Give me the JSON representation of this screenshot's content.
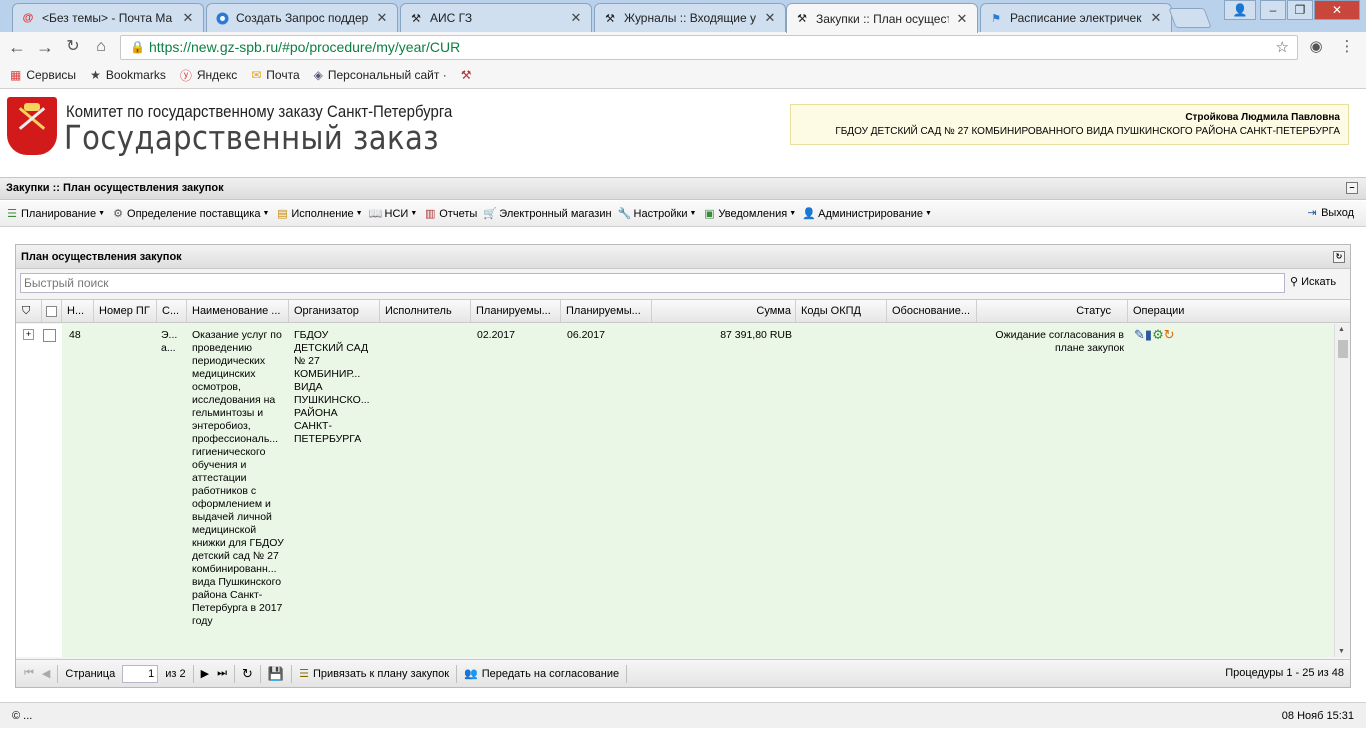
{
  "browser": {
    "tabs": [
      {
        "title": "<Без темы> - Почта Ма",
        "icon": "mail-at-icon",
        "active": false
      },
      {
        "title": "Создать Запрос поддер",
        "icon": "support-globe-icon",
        "active": false
      },
      {
        "title": "АИС ГЗ",
        "icon": "gavel-icon",
        "active": false
      },
      {
        "title": "Журналы :: Входящие у",
        "icon": "gavel-icon",
        "active": false
      },
      {
        "title": "Закупки :: План осущест",
        "icon": "gavel-icon",
        "active": true
      },
      {
        "title": "Расписание электричек",
        "icon": "train-icon",
        "active": false
      }
    ],
    "url": "https://new.gz-spb.ru/#po/procedure/my/year/CUR",
    "bookmarks": [
      {
        "label": "Сервисы",
        "icon": "apps-grid-icon"
      },
      {
        "label": "Bookmarks",
        "icon": "star-icon"
      },
      {
        "label": "Яндекс",
        "icon": "yandex-icon"
      },
      {
        "label": "Почта",
        "icon": "mail-envelope-icon"
      },
      {
        "label": "Персональный сайт ·",
        "icon": "site-icon"
      },
      {
        "label": "",
        "icon": "gavel-icon"
      }
    ]
  },
  "header": {
    "subtitle": "Комитет по государственному заказу Санкт-Петербурга",
    "title": "Государственный заказ",
    "user_name": "Стройкова Людмила Павловна",
    "organization": "ГБДОУ ДЕТСКИЙ САД № 27 КОМБИНИРОВАННОГО ВИДА ПУШКИНСКОГО РАЙОНА САНКТ-ПЕТЕРБУРГА"
  },
  "panel": {
    "title": "Закупки :: План осуществления закупок"
  },
  "menu": {
    "items": [
      {
        "label": "Планирование",
        "dropdown": true,
        "icon": "planning-icon"
      },
      {
        "label": "Определение поставщика",
        "dropdown": true,
        "icon": "gears-icon"
      },
      {
        "label": "Исполнение",
        "dropdown": true,
        "icon": "execution-icon"
      },
      {
        "label": "НСИ",
        "dropdown": true,
        "icon": "book-icon"
      },
      {
        "label": "Отчеты",
        "dropdown": false,
        "icon": "report-icon"
      },
      {
        "label": "Электронный магазин",
        "dropdown": false,
        "icon": "cart-icon"
      },
      {
        "label": "Настройки",
        "dropdown": true,
        "icon": "wrench-icon"
      },
      {
        "label": "Уведомления",
        "dropdown": true,
        "icon": "notification-icon"
      },
      {
        "label": "Администрирование",
        "dropdown": true,
        "icon": "user-icon"
      }
    ],
    "logout": "Выход"
  },
  "grid": {
    "title": "План осуществления закупок",
    "search_placeholder": "Быстрый поиск",
    "search_button": "Искать",
    "columns": [
      "Н...",
      "Номер ПГ",
      "С...",
      "Наименование ...",
      "Организатор",
      "Исполнитель",
      "Планируемы...",
      "Планируемы...",
      "Сумма",
      "Коды ОКПД",
      "Обоснование...",
      "Статус",
      "Операции"
    ],
    "row": {
      "number": "48",
      "pg_number": "",
      "s": "Э... а...",
      "name": "Оказание услуг по проведению периодических медицинских осмотров, исследования на гельминтозы и энтеробиоз, профессиональ... гигиенического обучения и аттестации работников с оформлением и выдачей личной медицинской книжки для ГБДОУ детский сад № 27 комбинированн... вида Пушкинского района Санкт-Петербурга в 2017 году",
      "organizer": "ГБДОУ ДЕТСКИЙ САД № 27 КОМБИНИР... ВИДА ПУШКИНСКО... РАЙОНА САНКТ-ПЕТЕРБУРГА",
      "executor": "",
      "plan_date1": "02.2017",
      "plan_date2": "06.2017",
      "sum": "87 391,80 RUB",
      "okpd": "",
      "justification": "",
      "status": "Ожидание согласования в плане закупок"
    },
    "paging": {
      "page_label": "Страница",
      "page": "1",
      "of": "из 2",
      "link_button": "Привязать к плану закупок",
      "send_button": "Передать на согласование",
      "info": "Процедуры 1 - 25 из 48"
    }
  },
  "statusbar": {
    "left": "© ...",
    "right": "08 Нояб 15:31"
  },
  "colors": {
    "row_bg": "#eaf6e6",
    "user_box_bg": "#fdfbe3",
    "emblem": "#d21a1a"
  }
}
